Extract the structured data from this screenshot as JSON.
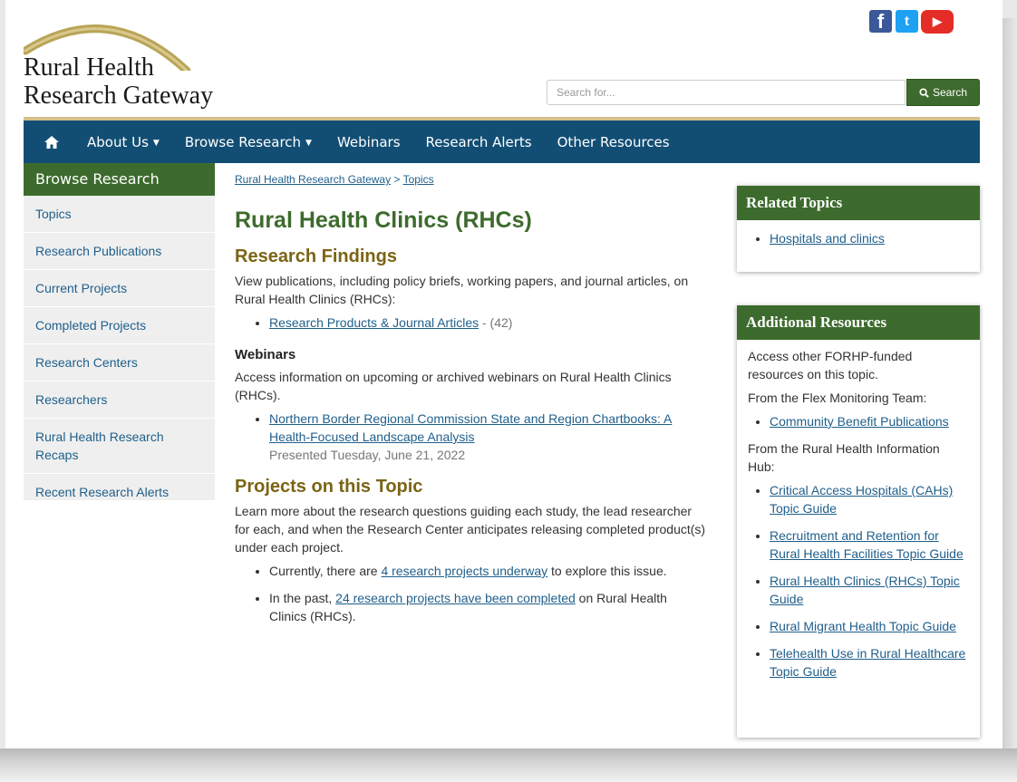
{
  "header": {
    "logo_line1": "Rural Health",
    "logo_line2": "Research Gateway",
    "social": {
      "facebook": "f",
      "twitter": "t",
      "youtube": "▶"
    },
    "search": {
      "placeholder": "Search for...",
      "button_label": "Search"
    }
  },
  "nav": {
    "items": [
      "About Us",
      "Browse Research",
      "Webinars",
      "Research Alerts",
      "Other Resources"
    ]
  },
  "sidebar": {
    "title": "Browse Research",
    "items": [
      "Topics",
      "Research Publications",
      "Current Projects",
      "Completed Projects",
      "Research Centers",
      "Researchers",
      "Rural Health Research Recaps",
      "Recent Research Alerts"
    ]
  },
  "breadcrumb": {
    "home": "Rural Health Research Gateway",
    "separator": ">",
    "current": "Topics"
  },
  "main": {
    "title": "Rural Health Clinics (RHCs)",
    "findings": {
      "heading": "Research Findings",
      "intro": "View publications, including policy briefs, working papers, and journal articles, on Rural Health Clinics (RHCs):",
      "link": "Research Products & Journal Articles",
      "count": " - (42)"
    },
    "webinars": {
      "heading": "Webinars",
      "intro": "Access information on upcoming or archived webinars on Rural Health Clinics (RHCs).",
      "link": "Northern Border Regional Commission State and Region Chartbooks: A Health-Focused Landscape Analysis",
      "date": "Presented Tuesday, June 21, 2022"
    },
    "projects": {
      "heading": "Projects on this Topic",
      "intro": "Learn more about the research questions guiding each study, the lead researcher for each, and when the Research Center anticipates releasing completed product(s) under each project.",
      "current_pre": "Currently, there are ",
      "current_link": "4 research projects underway",
      "current_post": " to explore this issue.",
      "past_pre": "In the past, ",
      "past_link": "24 research projects have been completed",
      "past_post": " on Rural Health Clinics (RHCs)."
    }
  },
  "related": {
    "title": "Related Topics",
    "items": [
      "Hospitals and clinics"
    ]
  },
  "additional": {
    "title": "Additional Resources",
    "intro": "Access other FORHP-funded resources on this topic.",
    "flex_label": "From the Flex Monitoring Team:",
    "flex_items": [
      "Community Benefit Publications"
    ],
    "hub_label": "From the Rural Health Information Hub:",
    "hub_items": [
      "Critical Access Hospitals (CAHs) Topic Guide",
      "Recruitment and Retention for Rural Health Facilities Topic Guide",
      "Rural Health Clinics (RHCs) Topic Guide",
      "Rural Migrant Health Topic Guide",
      "Telehealth Use in Rural Healthcare Topic Guide"
    ]
  }
}
